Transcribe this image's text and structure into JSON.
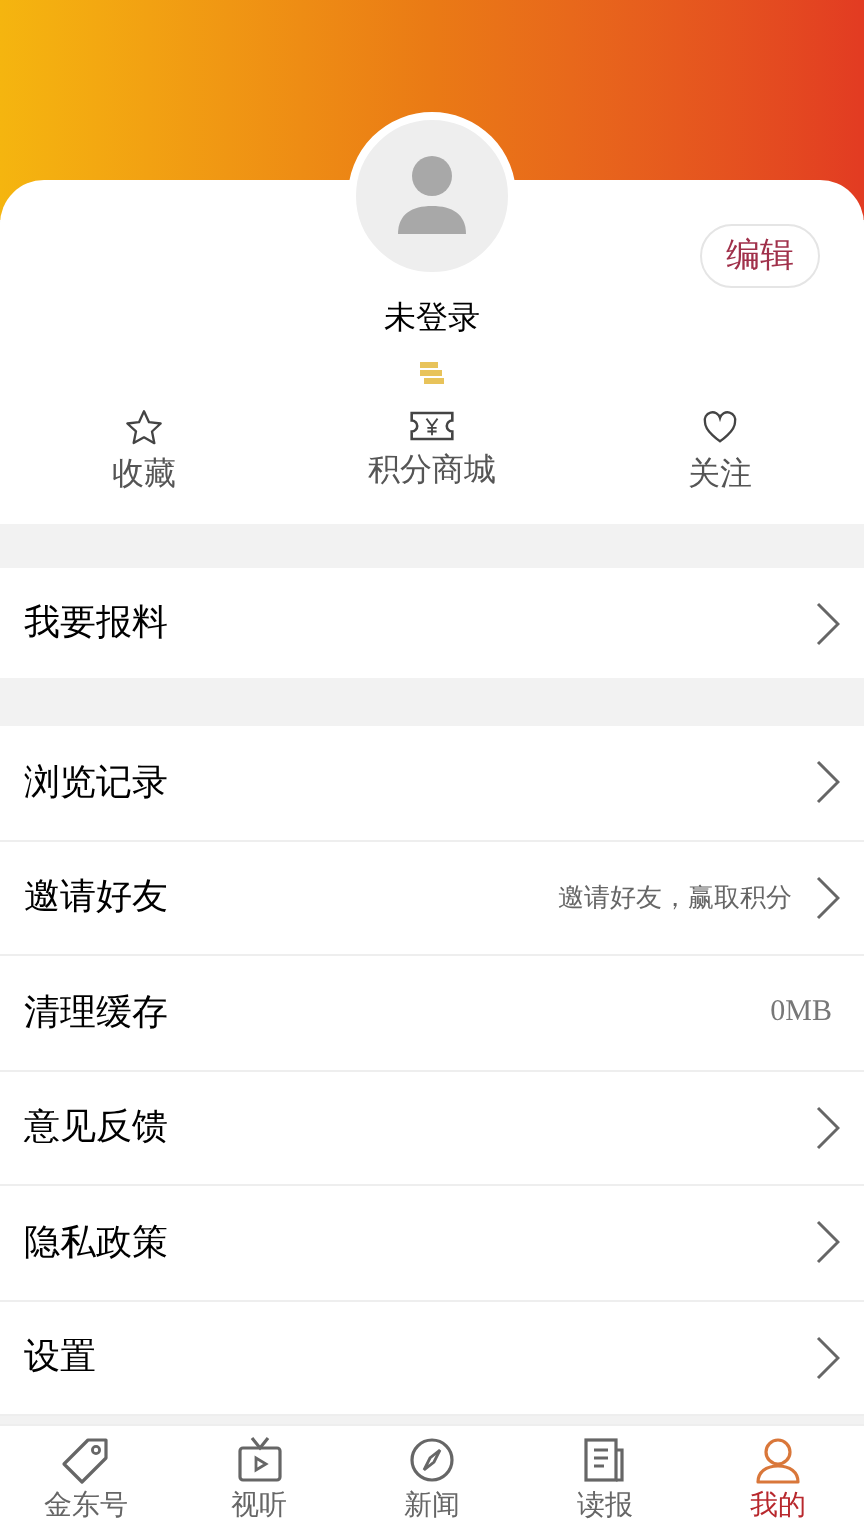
{
  "profile": {
    "name": "未登录",
    "edit_button": "编辑"
  },
  "quick_actions": [
    {
      "label": "收藏"
    },
    {
      "label": "积分商城"
    },
    {
      "label": "关注"
    }
  ],
  "report_row": {
    "label": "我要报料"
  },
  "menu": [
    {
      "label": "浏览记录",
      "kind": "arrow"
    },
    {
      "label": "邀请好友",
      "kind": "arrow",
      "hint": "邀请好友，赢取积分"
    },
    {
      "label": "清理缓存",
      "kind": "value",
      "value": "0MB"
    },
    {
      "label": "意见反馈",
      "kind": "arrow"
    },
    {
      "label": "隐私政策",
      "kind": "arrow"
    },
    {
      "label": "设置",
      "kind": "arrow"
    }
  ],
  "tab_bar": [
    {
      "label": "金东号",
      "selected": false
    },
    {
      "label": "视听",
      "selected": false
    },
    {
      "label": "新闻",
      "selected": false
    },
    {
      "label": "读报",
      "selected": false
    },
    {
      "label": "我的",
      "selected": true
    }
  ]
}
